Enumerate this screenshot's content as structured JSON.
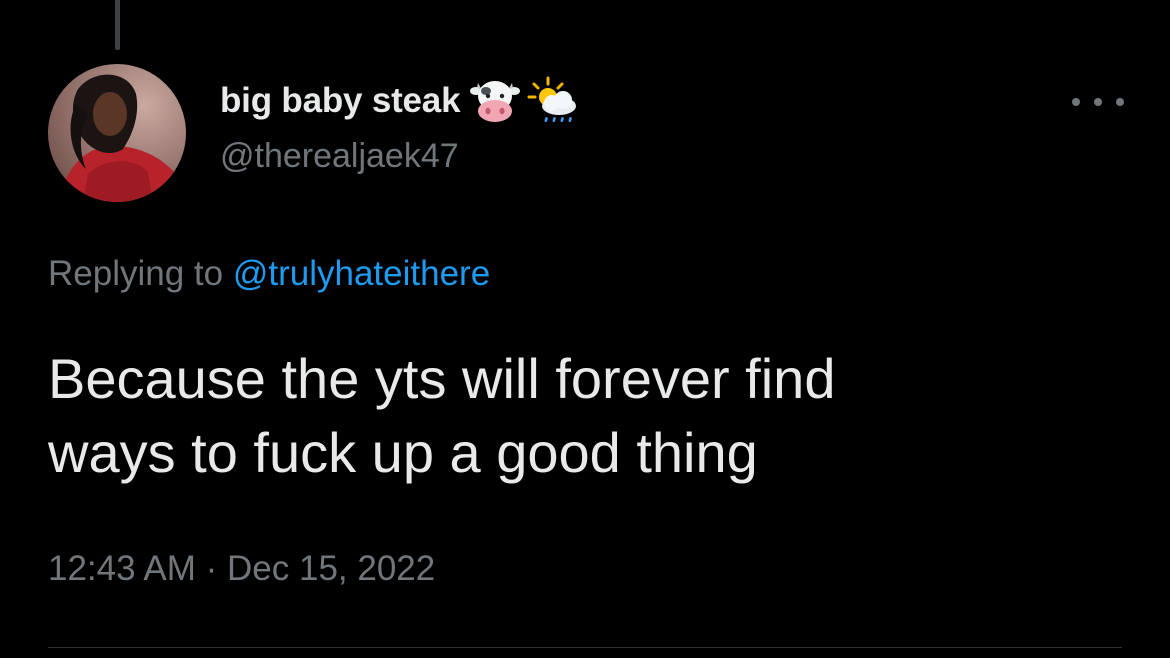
{
  "tweet": {
    "display_name": "big baby steak",
    "name_emojis": [
      "cow-face-emoji",
      "sun-behind-rain-cloud-emoji"
    ],
    "handle": "@therealjaek47",
    "replying_label": "Replying to",
    "replying_to": "@trulyhateithere",
    "text_line1": "Because the yts will forever find",
    "text_line2": "ways to fuck up a good thing",
    "time": "12:43 AM",
    "separator": "·",
    "date": "Dec 15, 2022"
  },
  "colors": {
    "background": "#000000",
    "primary_text": "#e7e9ea",
    "secondary_text": "#71767b",
    "link": "#1d9bf0",
    "divider": "#2f3336"
  },
  "icons": {
    "more": "more-horizontal-icon"
  }
}
